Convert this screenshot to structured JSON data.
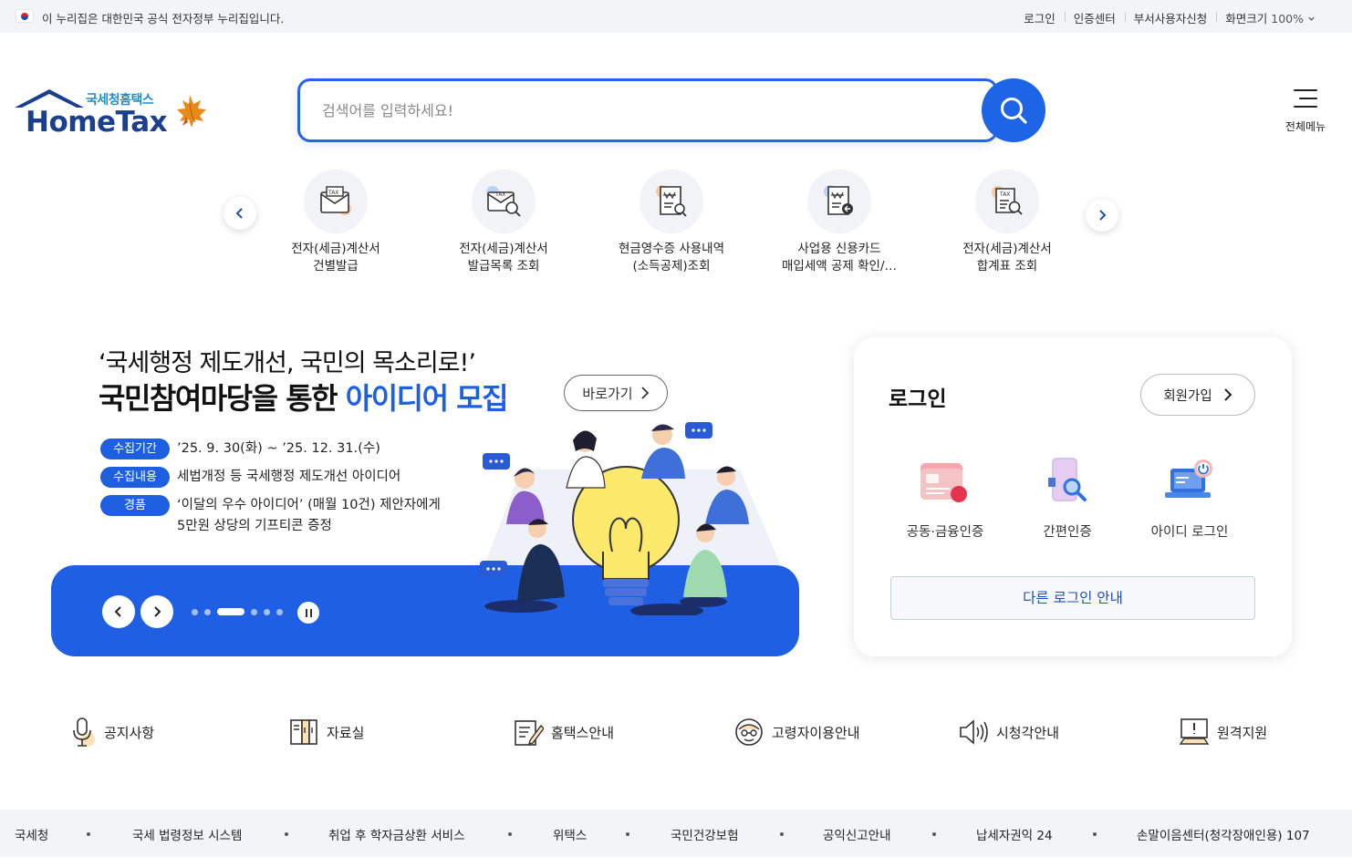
{
  "topbar": {
    "notice": "이 누리집은 대한민국 공식 전자정부 누리집입니다.",
    "links": [
      "로그인",
      "인증센터",
      "부서사용자신청",
      "화면크기"
    ],
    "zoom": "100%"
  },
  "header": {
    "logo_small": "국세청홈택스",
    "logo_big": "HomeTax",
    "search_placeholder": "검색어를 입력하세요!",
    "menu_label": "전체메뉴"
  },
  "quick_menu": [
    {
      "label": "전자(세금)계산서\n건별발급",
      "icon": "tax-envelope-icon"
    },
    {
      "label": "전자(세금)계산서\n발급목록 조회",
      "icon": "tax-search-icon"
    },
    {
      "label": "현금영수증 사용내역\n(소득공제)조회",
      "icon": "receipt-search-icon"
    },
    {
      "label": "사업용 신용카드\n매입세액 공제 확인/…",
      "icon": "card-receipt-icon"
    },
    {
      "label": "전자(세금)계산서\n합계표 조회",
      "icon": "tax-summary-icon"
    }
  ],
  "banner": {
    "line1": "‘국세행정 제도개선, 국민의 목소리로!’",
    "line2_prefix": "국민참여마당을 통한 ",
    "line2_accent": "아이디어 모집",
    "go_button": "바로가기",
    "info": [
      {
        "tag": "수집기간",
        "text": "’25. 9. 30(화) ~ ’25. 12. 31.(수)"
      },
      {
        "tag": "수집내용",
        "text": "세법개정 등 국세행정 제도개선 아이디어"
      },
      {
        "tag": "경품",
        "text": "‘이달의 우수 아이디어’ (매월 10건) 제안자에게\n5만원 상당의 기프티콘 증정"
      }
    ],
    "active_slide": 3,
    "slide_count": 6
  },
  "login": {
    "title": "로그인",
    "join_button": "회원가입",
    "options": [
      "공동·금융인증",
      "간편인증",
      "아이디 로그인"
    ],
    "other_button": "다른 로그인 안내"
  },
  "services": [
    "공지사항",
    "자료실",
    "홈택스안내",
    "고령자이용안내",
    "시청각안내",
    "원격지원"
  ],
  "footer_links": [
    "국세청",
    "국세 법령정보 시스템",
    "취업 후 학자금상환 서비스",
    "위택스",
    "국민건강보험",
    "공익신고안내",
    "납세자권익 24",
    "손말이음센터(청각장애인용) 107"
  ],
  "colors": {
    "primary": "#1e5fe0",
    "search_border": "#2563eb",
    "topbar_bg": "#f2f4f7"
  }
}
